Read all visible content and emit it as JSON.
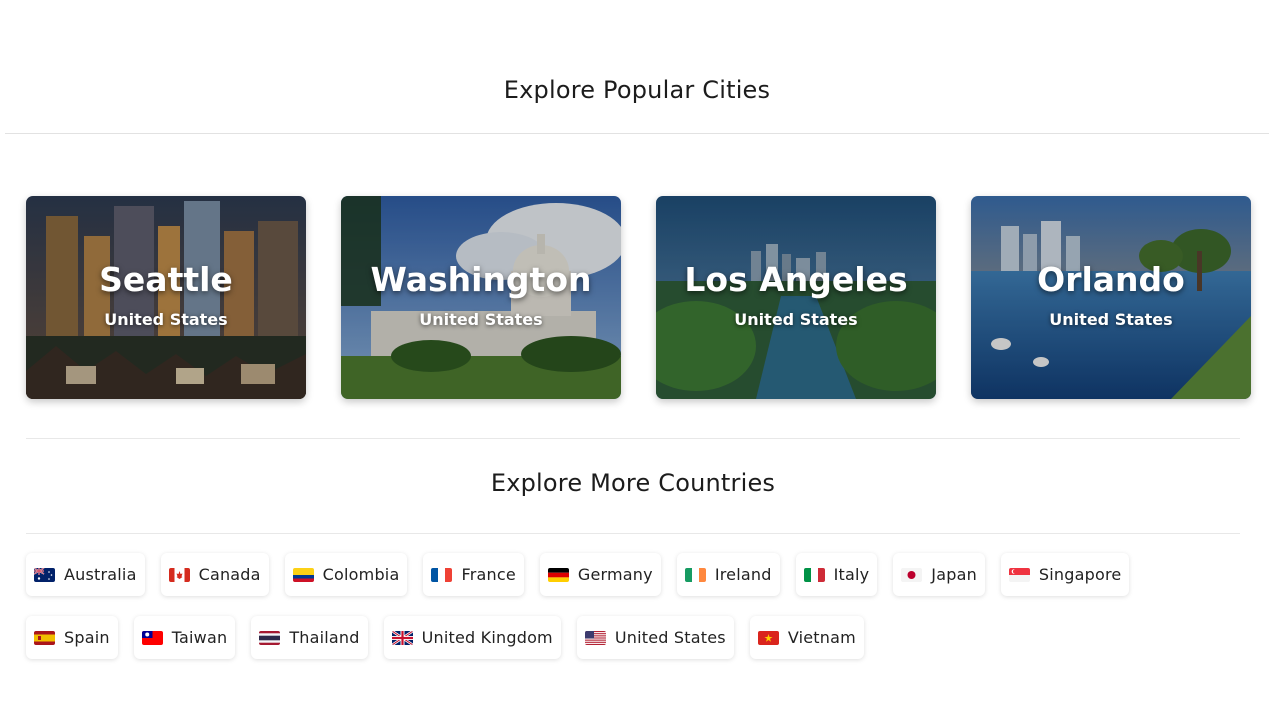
{
  "sections": {
    "cities_title": "Explore Popular Cities",
    "countries_title": "Explore More Countries"
  },
  "cities": [
    {
      "name": "Seattle",
      "country": "United States"
    },
    {
      "name": "Washington",
      "country": "United States"
    },
    {
      "name": "Los Angeles",
      "country": "United States"
    },
    {
      "name": "Orlando",
      "country": "United States"
    }
  ],
  "countries": [
    {
      "label": "Australia",
      "flag": "australia-flag-icon"
    },
    {
      "label": "Canada",
      "flag": "canada-flag-icon"
    },
    {
      "label": "Colombia",
      "flag": "colombia-flag-icon"
    },
    {
      "label": "France",
      "flag": "france-flag-icon"
    },
    {
      "label": "Germany",
      "flag": "germany-flag-icon"
    },
    {
      "label": "Ireland",
      "flag": "ireland-flag-icon"
    },
    {
      "label": "Italy",
      "flag": "italy-flag-icon"
    },
    {
      "label": "Japan",
      "flag": "japan-flag-icon"
    },
    {
      "label": "Singapore",
      "flag": "singapore-flag-icon"
    },
    {
      "label": "Spain",
      "flag": "spain-flag-icon"
    },
    {
      "label": "Taiwan",
      "flag": "taiwan-flag-icon"
    },
    {
      "label": "Thailand",
      "flag": "thailand-flag-icon"
    },
    {
      "label": "United Kingdom",
      "flag": "united-kingdom-flag-icon"
    },
    {
      "label": "United States",
      "flag": "united-states-flag-icon"
    },
    {
      "label": "Vietnam",
      "flag": "vietnam-flag-icon"
    }
  ]
}
